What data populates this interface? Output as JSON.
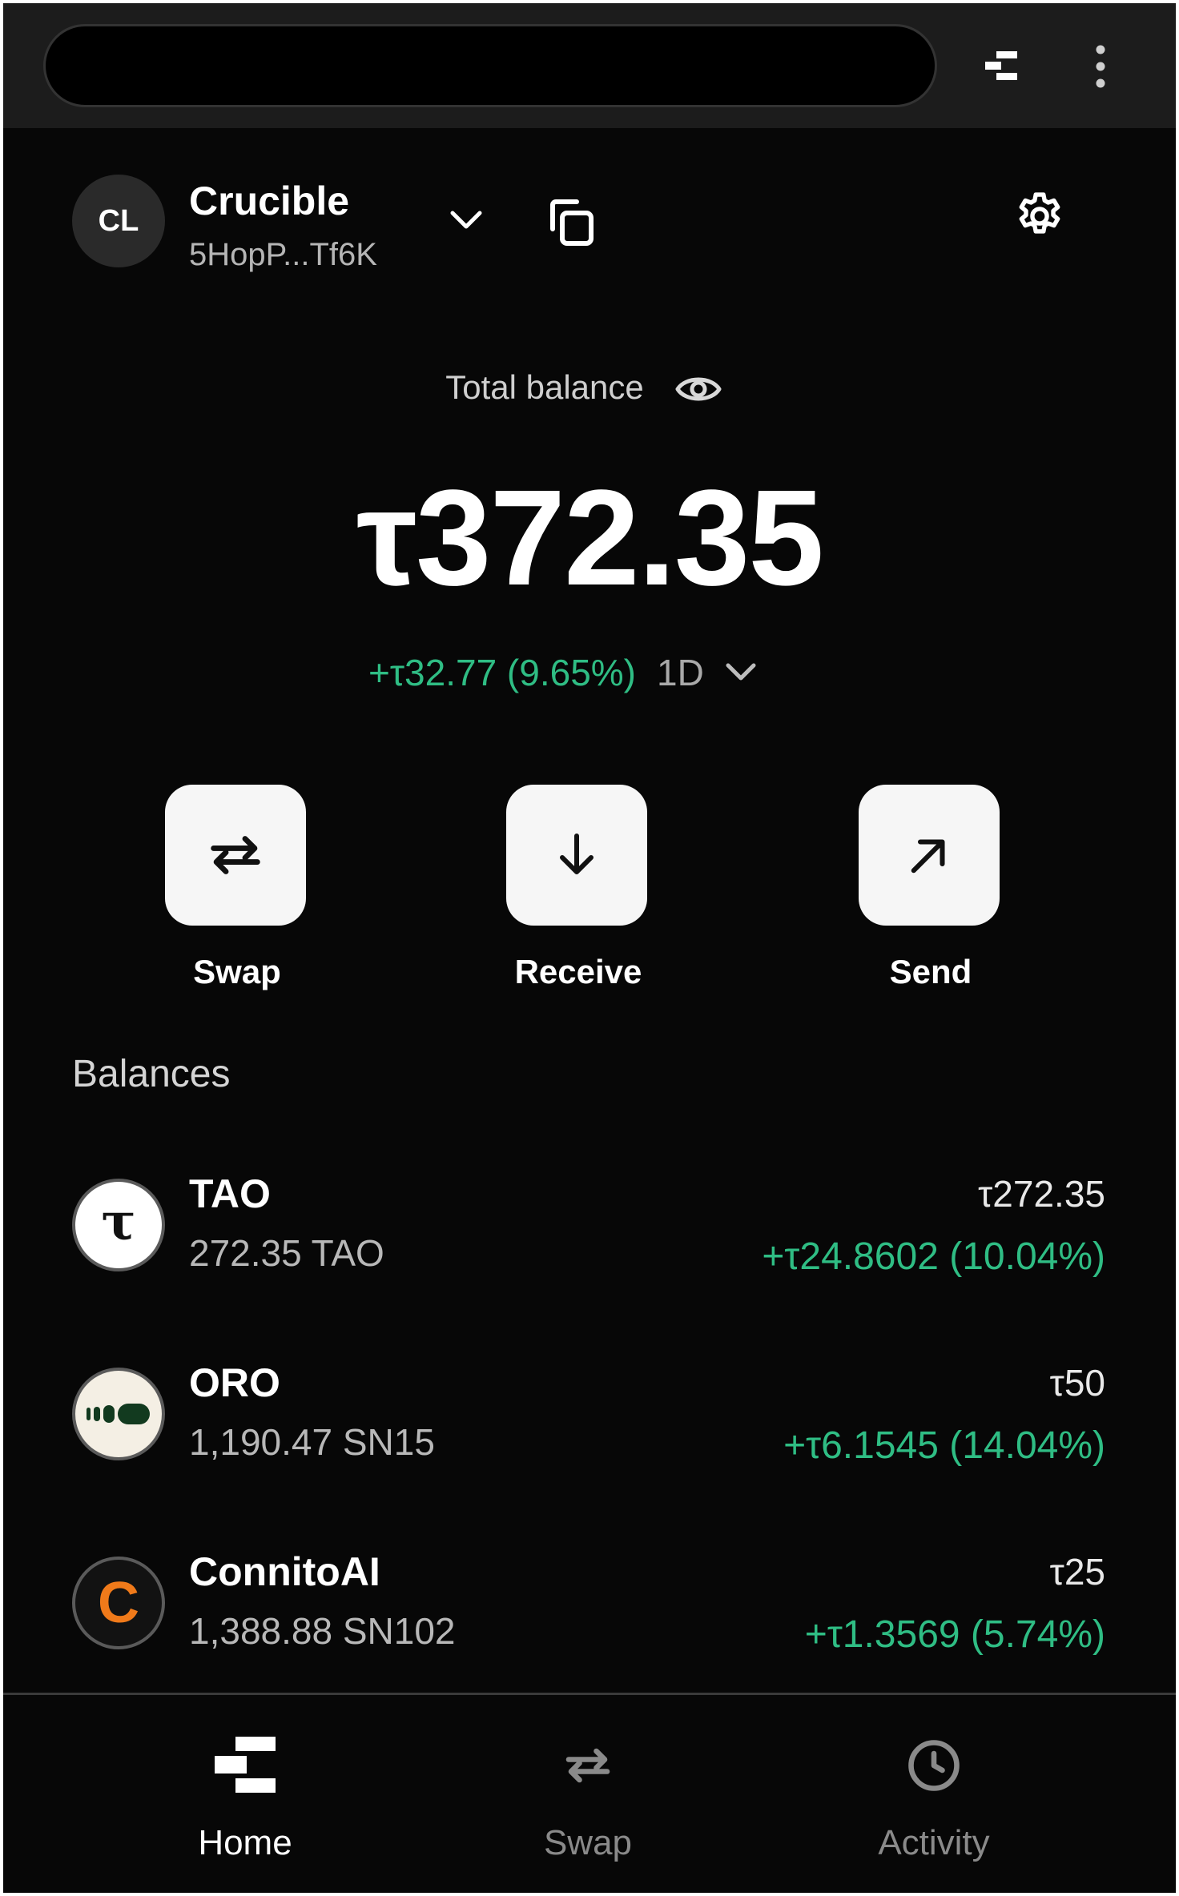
{
  "account": {
    "initials": "CL",
    "name": "Crucible",
    "address": "5HopP...Tf6K"
  },
  "balance": {
    "label": "Total balance",
    "value": "τ372.35",
    "change": "+τ32.77 (9.65%)",
    "period": "1D"
  },
  "actions": [
    {
      "label": "Swap",
      "icon": "swap-arrows-icon"
    },
    {
      "label": "Receive",
      "icon": "arrow-down-icon"
    },
    {
      "label": "Send",
      "icon": "arrow-up-right-icon"
    }
  ],
  "balances": {
    "title": "Balances",
    "tokens": [
      {
        "name": "TAO",
        "amount": "272.35 TAO",
        "value": "τ272.35",
        "change": "+τ24.8602 (10.04%)",
        "icon_text": "τ"
      },
      {
        "name": "ORO",
        "amount": "1,190.47 SN15",
        "value": "τ50",
        "change": "+τ6.1545 (14.04%)"
      },
      {
        "name": "ConnitoAI",
        "amount": "1,388.88 SN102",
        "value": "τ25",
        "change": "+τ1.3569 (5.74%)",
        "icon_text": "C"
      }
    ]
  },
  "nav": [
    {
      "label": "Home",
      "active": true
    },
    {
      "label": "Swap",
      "active": false
    },
    {
      "label": "Activity",
      "active": false
    }
  ],
  "colors": {
    "background": "#070707",
    "positive": "#2fbd84",
    "accent_orange": "#f07a1a"
  }
}
